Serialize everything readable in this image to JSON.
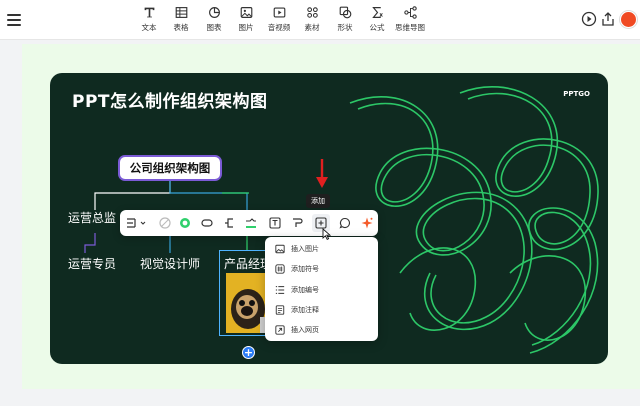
{
  "toolbar": {
    "items": [
      {
        "label": "文本",
        "icon": "text-icon"
      },
      {
        "label": "表格",
        "icon": "table-icon"
      },
      {
        "label": "图表",
        "icon": "chart-icon"
      },
      {
        "label": "图片",
        "icon": "image-icon"
      },
      {
        "label": "音视频",
        "icon": "media-icon"
      },
      {
        "label": "素材",
        "icon": "material-icon"
      },
      {
        "label": "形状",
        "icon": "shape-icon"
      },
      {
        "label": "公式",
        "icon": "formula-icon"
      },
      {
        "label": "思维导图",
        "icon": "mindmap-icon"
      }
    ],
    "right_icons": [
      "play-icon",
      "share-icon",
      "avatar"
    ]
  },
  "slide": {
    "title": "PPT怎么制作组织架构图",
    "brand": "PPTGO",
    "org_root": "公司组织架构图",
    "nodes": {
      "level1_left": "运营总监",
      "level2_a": "运营专员",
      "level2_b": "视觉设计师",
      "level2_c": "产品经理"
    }
  },
  "floating_toolbar": {
    "tooltip": "添加",
    "buttons": [
      "layout-icon",
      "disabled-color-icon",
      "fill-color-icon",
      "border-shape-icon",
      "connector-icon",
      "line-color-icon",
      "text-style-icon",
      "format-brush-icon",
      "add-icon",
      "comment-icon",
      "ai-sparkle-icon"
    ]
  },
  "dropdown": {
    "items": [
      {
        "label": "插入图片",
        "icon": "image-icon"
      },
      {
        "label": "添加符号",
        "icon": "hash-icon"
      },
      {
        "label": "添加编号",
        "icon": "list-number-icon"
      },
      {
        "label": "添加注释",
        "icon": "note-icon"
      },
      {
        "label": "插入网页",
        "icon": "web-page-icon"
      }
    ]
  },
  "colors": {
    "slide_bg": "#0f2a20",
    "canvas_bg": "#ecfbe9",
    "accent_green": "#2fd06c",
    "root_border": "#7b5bd6",
    "arrow_red": "#e02020",
    "add_blue": "#2b7cf6"
  }
}
